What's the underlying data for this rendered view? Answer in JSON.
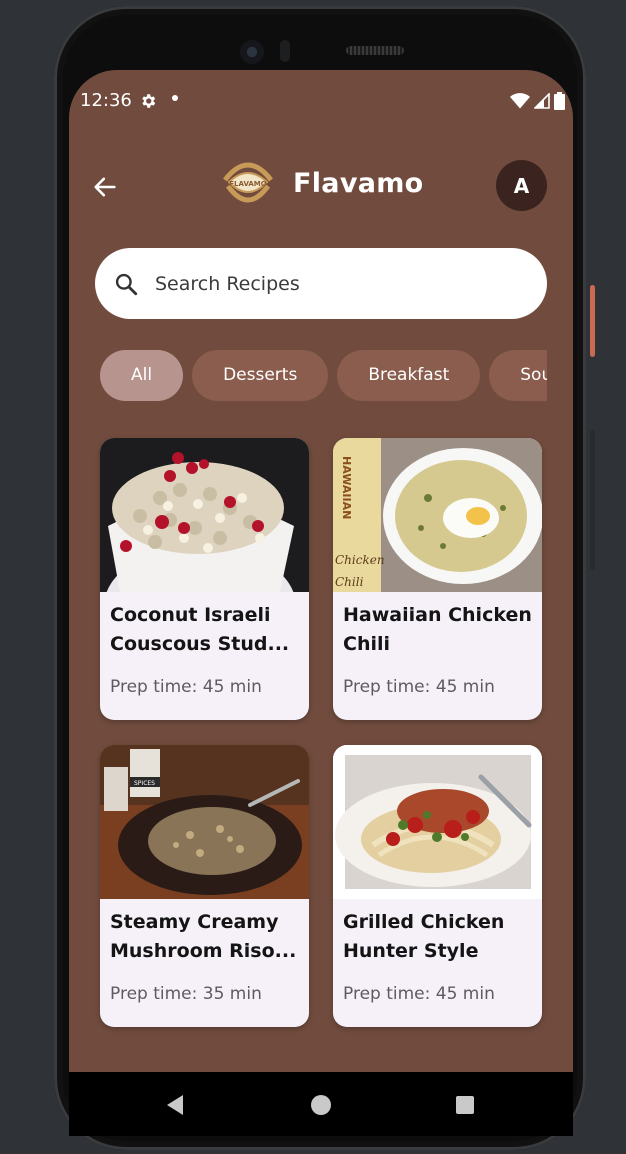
{
  "status_bar": {
    "time": "12:36",
    "icons": [
      "gear-icon",
      "notification-dot-icon",
      "wifi-icon",
      "signal-icon",
      "battery-icon"
    ]
  },
  "app_bar": {
    "title": "Flavamo",
    "logo_text": "FLAVAMO",
    "avatar_initial": "A"
  },
  "search": {
    "placeholder": "Search Recipes",
    "value": ""
  },
  "categories": {
    "selected": "All",
    "items": [
      "All",
      "Desserts",
      "Breakfast",
      "Soups"
    ]
  },
  "recipes": [
    {
      "name": "Coconut Israeli Couscous Stud...",
      "prep": "Prep time: 45 min"
    },
    {
      "name": "Hawaiian Chicken Chili",
      "prep": "Prep time: 45 min",
      "image_text": [
        "HAWAIIAN",
        "Chicken",
        "Chili"
      ]
    },
    {
      "name": "Steamy Creamy Mushroom Riso...",
      "prep": "Prep time: 35 min",
      "image_text": [
        "SPICES"
      ]
    },
    {
      "name": "Grilled Chicken Hunter Style",
      "prep": "Prep time: 45 min"
    }
  ],
  "colors": {
    "background": "#714c3e",
    "chip": "#8a5d4e",
    "chip_selected": "#b7958e",
    "card": "#f6f1f9",
    "avatar": "#3b241f"
  }
}
